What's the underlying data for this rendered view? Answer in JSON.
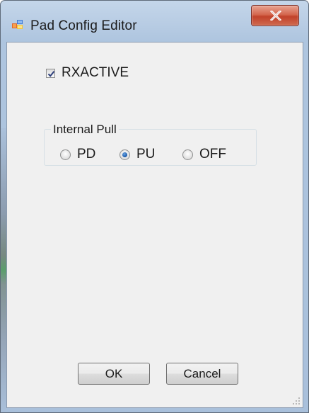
{
  "window": {
    "title": "Pad Config Editor",
    "close_icon": "close-icon",
    "app_icon": "form-icon"
  },
  "rxactive": {
    "label": "RXACTIVE",
    "checked": true
  },
  "internal_pull": {
    "title": "Internal Pull",
    "options": [
      {
        "label": "PD",
        "checked": false
      },
      {
        "label": "PU",
        "checked": true
      },
      {
        "label": "OFF",
        "checked": false
      }
    ]
  },
  "buttons": {
    "ok_label": "OK",
    "cancel_label": "Cancel"
  },
  "colors": {
    "frame_blue": "#b9cde4",
    "close_red": "#c2422a",
    "client_bg": "#f0f0f0"
  }
}
